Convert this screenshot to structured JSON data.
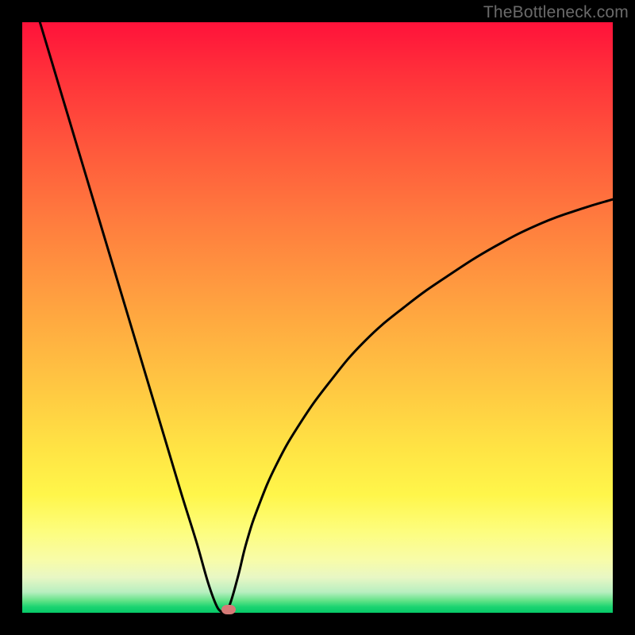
{
  "watermark": "TheBottleneck.com",
  "colors": {
    "frame": "#000000",
    "curve": "#000000",
    "marker": "#d67a77",
    "gradient_top": "#ff123a",
    "gradient_bottom": "#06c968"
  },
  "chart_data": {
    "type": "line",
    "title": "",
    "xlabel": "",
    "ylabel": "",
    "xlim": [
      0,
      100
    ],
    "ylim": [
      0,
      100
    ],
    "grid": false,
    "legend": false,
    "annotations": [],
    "description": "Bottleneck-style V curve. Left branch descends steeply from (≈3,100) to a minimum near x≈34 at y≈0; right branch rises with decreasing slope reaching only y≈70 at x=100.",
    "minimum": {
      "x": 34,
      "y": 0
    },
    "left_branch": [
      {
        "x": 3,
        "y": 100
      },
      {
        "x": 6,
        "y": 90
      },
      {
        "x": 9,
        "y": 80
      },
      {
        "x": 12,
        "y": 70
      },
      {
        "x": 15,
        "y": 60
      },
      {
        "x": 18,
        "y": 50
      },
      {
        "x": 21,
        "y": 40
      },
      {
        "x": 24,
        "y": 30
      },
      {
        "x": 27,
        "y": 20
      },
      {
        "x": 29.5,
        "y": 12
      },
      {
        "x": 31.5,
        "y": 5
      },
      {
        "x": 33,
        "y": 1
      },
      {
        "x": 34,
        "y": 0
      }
    ],
    "right_branch": [
      {
        "x": 34,
        "y": 0
      },
      {
        "x": 35,
        "y": 1
      },
      {
        "x": 36.5,
        "y": 6
      },
      {
        "x": 38,
        "y": 12
      },
      {
        "x": 40,
        "y": 18
      },
      {
        "x": 43,
        "y": 25
      },
      {
        "x": 47,
        "y": 32
      },
      {
        "x": 52,
        "y": 39
      },
      {
        "x": 58,
        "y": 46
      },
      {
        "x": 65,
        "y": 52
      },
      {
        "x": 72,
        "y": 57
      },
      {
        "x": 80,
        "y": 62
      },
      {
        "x": 88,
        "y": 66
      },
      {
        "x": 95,
        "y": 68.5
      },
      {
        "x": 100,
        "y": 70
      }
    ],
    "marker": {
      "x": 35,
      "y": 0.5,
      "shape": "pill",
      "color": "#d67a77"
    }
  }
}
